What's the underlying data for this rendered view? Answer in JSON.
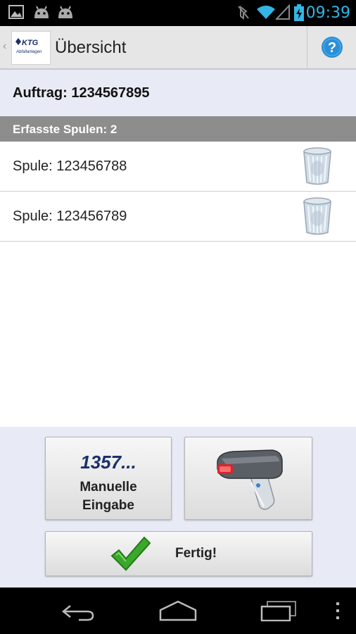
{
  "status_bar": {
    "time": "09:39",
    "left_icons": [
      "gallery-icon",
      "android-icon",
      "android-icon"
    ],
    "right_icons": [
      "mute-icon",
      "wifi-icon",
      "signal-icon",
      "battery-charging-icon"
    ],
    "time_color": "#33b5e5"
  },
  "action_bar": {
    "logo_text": "KTG",
    "logo_subtext": "Abfallanlagen",
    "title": "Übersicht",
    "help_icon": "help-icon"
  },
  "order": {
    "label": "Auftrag: 1234567895"
  },
  "section": {
    "label": "Erfasste Spulen: 2"
  },
  "spools": [
    {
      "label": "Spule: 123456788",
      "icon": "trash-icon"
    },
    {
      "label": "Spule: 123456789",
      "icon": "trash-icon"
    }
  ],
  "buttons": {
    "manual_number": "1357...",
    "manual_line1": "Manuelle",
    "manual_line2": "Eingabe",
    "scan_icon": "barcode-scanner-icon",
    "done_label": "Fertig!",
    "done_icon": "checkmark-icon"
  },
  "nav_bar": {
    "items": [
      "back-icon",
      "home-icon",
      "recent-apps-icon",
      "menu-icon"
    ]
  },
  "colors": {
    "panel_background": "#e8ebf5",
    "section_header": "#8d8d8d",
    "brand_blue": "#1b2f6b",
    "check_green": "#3aa82a"
  }
}
